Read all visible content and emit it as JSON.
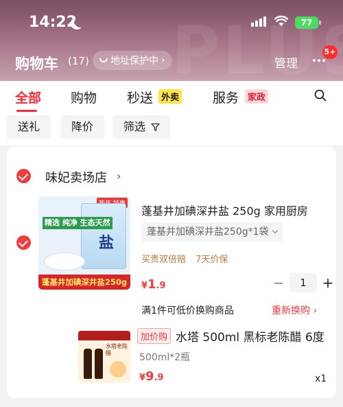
{
  "status_bar": {
    "time": "14:22",
    "battery": "77"
  },
  "header": {
    "title": "购物车",
    "count": "(17)",
    "address_pill": "地址保护中",
    "manage": "管理",
    "more_badge": "5+",
    "watermark": "PLUS"
  },
  "tabs": [
    {
      "label": "全部",
      "active": true
    },
    {
      "label": "购物",
      "active": false
    },
    {
      "label": "秒送",
      "active": false,
      "tag": "外卖"
    },
    {
      "label": "服务",
      "active": false,
      "tag": "家政"
    }
  ],
  "filters": [
    "送礼",
    "降价",
    "筛选"
  ],
  "shop": {
    "name": "味妃卖场店"
  },
  "product": {
    "title": "蓬基井加碘深井盐 250g 家用厨房",
    "sku": "蓬基井加碘深井盐250g*1袋",
    "services": [
      "买贵双倍赔",
      "7天价保"
    ],
    "price_currency": "¥",
    "price_int": "1",
    "price_dec": ".9",
    "quantity": "1",
    "image_caption": "蓬基井加碘深井盐250g",
    "image_slogan": "精选 纯净 生态天然",
    "image_new_tag": "新年 特惠",
    "image_big_char": "盐"
  },
  "exchange": {
    "text": "满1件可低价换购商品",
    "action": "重新换购"
  },
  "gift": {
    "tag": "加价购",
    "title": "水塔 500ml 黑标老陈醋 6度",
    "spec": "500ml*2瓶",
    "price_currency": "¥",
    "price_int": "9",
    "price_dec": ".9",
    "qty": "x1",
    "image_label": "水塔老陈醋"
  },
  "colors": {
    "accent": "#ff2a36",
    "header_top": "#7a4e63",
    "battery": "#4cd964"
  }
}
